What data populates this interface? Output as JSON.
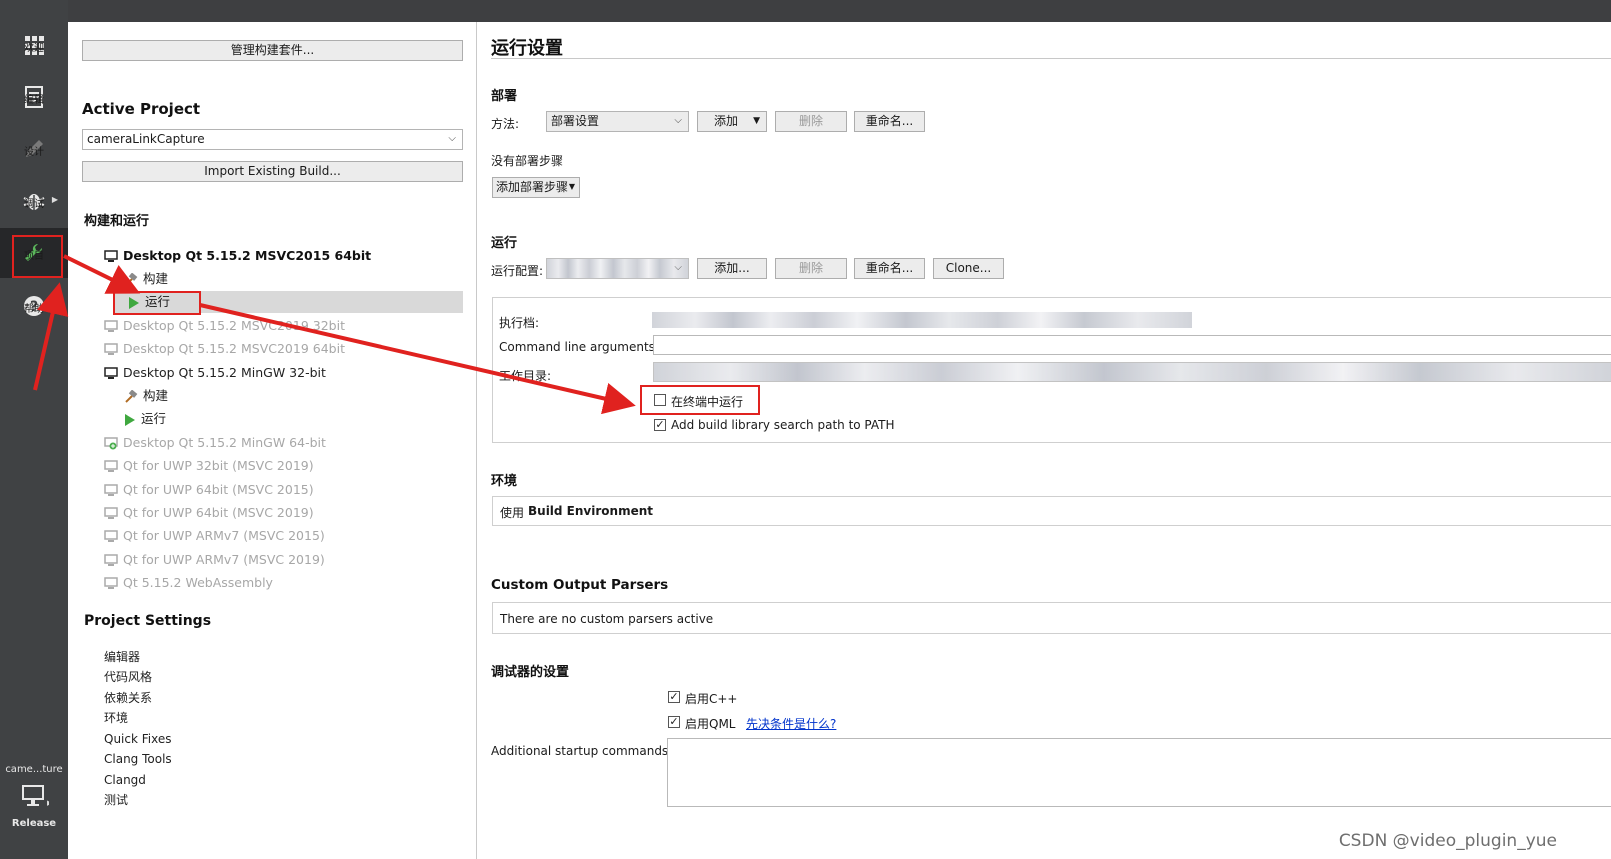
{
  "modebar": {
    "items": [
      {
        "label": "欢迎",
        "icon": "grid-icon"
      },
      {
        "label": "编辑",
        "icon": "document-icon"
      },
      {
        "label": "设计",
        "icon": "pencil-icon"
      },
      {
        "label": "调试",
        "icon": "bug-icon"
      },
      {
        "label": "项目",
        "icon": "wrench-icon"
      },
      {
        "label": "帮助",
        "icon": "help-icon"
      }
    ],
    "kit_selector": {
      "project": "came...ture",
      "build": "Release",
      "icon": "monitor-icon"
    }
  },
  "project_panel": {
    "manage_kits_button": "管理构建套件...",
    "active_project_heading": "Active Project",
    "active_project_value": "cameraLinkCapture",
    "import_build_button": "Import Existing Build...",
    "build_run_heading": "构建和运行",
    "kits": [
      {
        "name": "Desktop Qt 5.15.2 MSVC2015 64bit",
        "state": "active"
      },
      {
        "name": "Desktop Qt 5.15.2 MSVC2019 32bit",
        "state": "disabled"
      },
      {
        "name": "Desktop Qt 5.15.2 MSVC2019 64bit",
        "state": "disabled"
      },
      {
        "name": "Desktop Qt 5.15.2 MinGW 32-bit",
        "state": "enabled"
      },
      {
        "name": "Desktop Qt 5.15.2 MinGW 64-bit",
        "state": "disabled"
      },
      {
        "name": "Qt  for UWP 32bit (MSVC 2019)",
        "state": "disabled"
      },
      {
        "name": "Qt  for UWP 64bit (MSVC 2015)",
        "state": "disabled"
      },
      {
        "name": "Qt  for UWP 64bit (MSVC 2019)",
        "state": "disabled"
      },
      {
        "name": "Qt  for UWP ARMv7 (MSVC 2015)",
        "state": "disabled"
      },
      {
        "name": "Qt  for UWP ARMv7 (MSVC 2019)",
        "state": "disabled"
      },
      {
        "name": "Qt 5.15.2 WebAssembly",
        "state": "disabled"
      }
    ],
    "build_label": "构建",
    "run_label": "运行",
    "project_settings_heading": "Project Settings",
    "settings_items": [
      "编辑器",
      "代码风格",
      "依赖关系",
      "环境",
      "Quick Fixes",
      "Clang Tools",
      "Clangd",
      "测试"
    ]
  },
  "run_settings": {
    "title": "运行设置",
    "deploy": {
      "heading": "部署",
      "method_label": "方法:",
      "method_value": "部署设置",
      "add_button": "添加",
      "delete_button": "删除",
      "rename_button": "重命名...",
      "no_steps_label": "没有部署步骤",
      "add_step_button": "添加部署步骤"
    },
    "run": {
      "heading": "运行",
      "config_label": "运行配置:",
      "add_button": "添加...",
      "delete_button": "删除",
      "rename_button": "重命名...",
      "clone_button": "Clone...",
      "executable_label": "执行档:",
      "args_label": "Command line arguments:",
      "args_value": "",
      "workdir_label": "工作目录:",
      "run_in_terminal_label": "在终端中运行",
      "run_in_terminal_checked": false,
      "add_lib_path_label": "Add build library search path to PATH",
      "add_lib_path_checked": true
    },
    "environment": {
      "heading": "环境",
      "prefix": "使用",
      "value": "Build Environment"
    },
    "parsers": {
      "heading": "Custom Output Parsers",
      "text": "There are no custom parsers active"
    },
    "debugger": {
      "heading": "调试器的设置",
      "enable_cpp_label": "启用C++",
      "enable_cpp_checked": true,
      "enable_qml_label": "启用QML",
      "enable_qml_checked": true,
      "prereq_link": "先决条件是什么?",
      "startup_label": "Additional startup commands:"
    }
  },
  "watermark": "CSDN @video_plugin_yue",
  "colors": {
    "annotation_red": "#e0221f",
    "run_green": "#3fa83f"
  }
}
